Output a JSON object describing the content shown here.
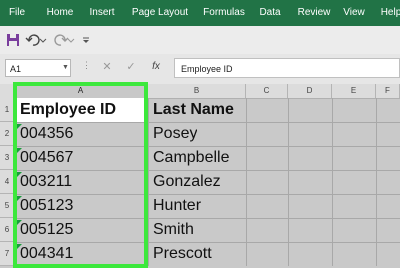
{
  "menu": [
    "File",
    "Home",
    "Insert",
    "Page Layout",
    "Formulas",
    "Data",
    "Review",
    "View",
    "Help"
  ],
  "qat": {
    "icons": [
      "save-icon",
      "undo-icon",
      "undo-dropdown-icon",
      "redo-icon",
      "redo-dropdown-icon",
      "customize-qat-icon"
    ]
  },
  "formula_bar": {
    "name_box": "A1",
    "cancel": "✕",
    "enter": "✓",
    "fx": "fx",
    "value": "Employee ID"
  },
  "columns": [
    "A",
    "B",
    "C",
    "D",
    "E",
    "F"
  ],
  "rows": [
    "1",
    "2",
    "3",
    "4",
    "5",
    "6",
    "7"
  ],
  "sheet": {
    "header": {
      "col_a": "Employee ID",
      "col_b": "Last Name"
    },
    "records": [
      {
        "id": "004356",
        "last_name": "Posey"
      },
      {
        "id": "004567",
        "last_name": "Campbelle"
      },
      {
        "id": "003211",
        "last_name": "Gonzalez"
      },
      {
        "id": "005123",
        "last_name": "Hunter"
      },
      {
        "id": "005125",
        "last_name": "Smith"
      },
      {
        "id": "004341",
        "last_name": "Prescott"
      }
    ]
  },
  "colors": {
    "ribbon": "#217346",
    "selection": "#3ce83c",
    "error_triangle": "#1a9c3c"
  }
}
